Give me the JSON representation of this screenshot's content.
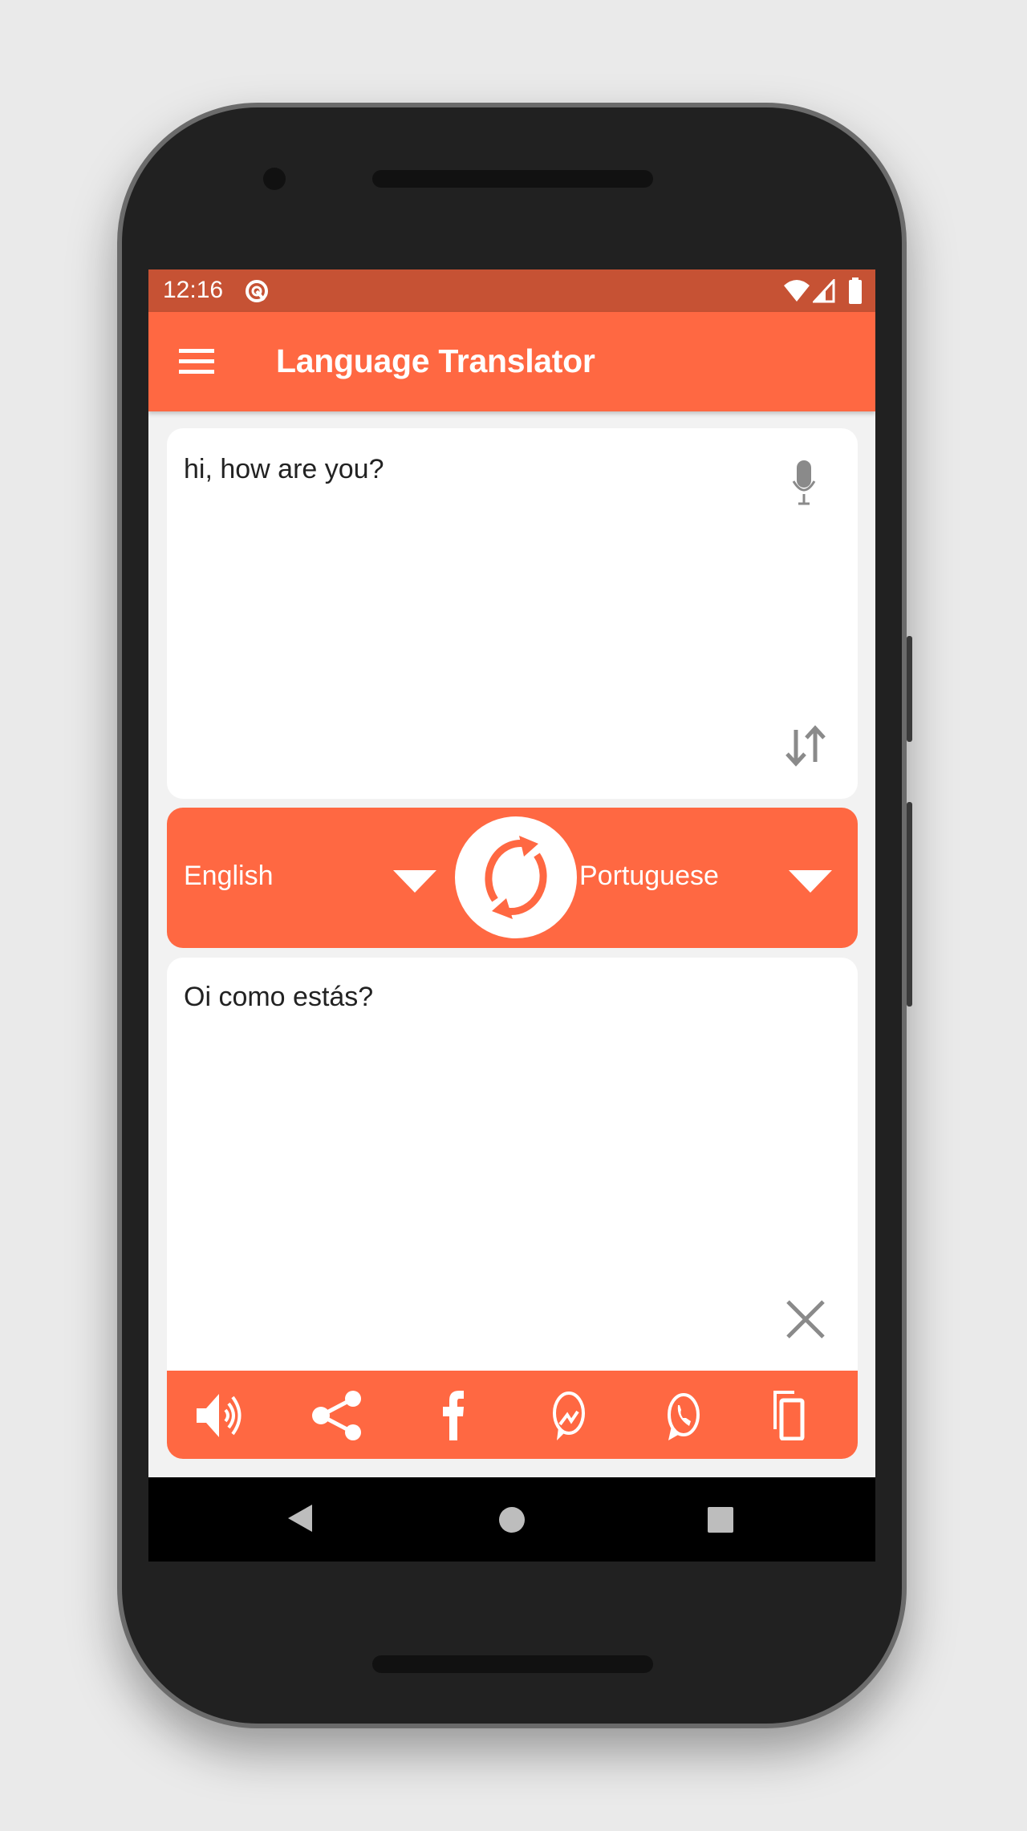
{
  "status_bar": {
    "time": "12:16",
    "icons": [
      "data-saver-icon",
      "wifi-icon",
      "signal-icon",
      "battery-icon"
    ]
  },
  "app_bar": {
    "title": "Language Translator",
    "menu_icon": "hamburger-menu-icon"
  },
  "input_card": {
    "text": "hi, how are you?",
    "icons": [
      "microphone-icon",
      "swap-vertical-icon"
    ]
  },
  "language_bar": {
    "source_language": "English",
    "target_language": "Portuguese",
    "swap_icon": "swap-languages-icon"
  },
  "output_card": {
    "text": "Oi como estás?",
    "clear_icon": "close-icon"
  },
  "action_bar": {
    "icons": [
      "speaker-icon",
      "share-icon",
      "facebook-icon",
      "messenger-icon",
      "whatsapp-icon",
      "copy-icon"
    ]
  },
  "nav_bar": {
    "icons": [
      "back-icon",
      "home-icon",
      "recents-icon"
    ]
  },
  "colors": {
    "accent": "#FF6842",
    "status_bar": "#C65234",
    "background": "#F2F2F2"
  }
}
